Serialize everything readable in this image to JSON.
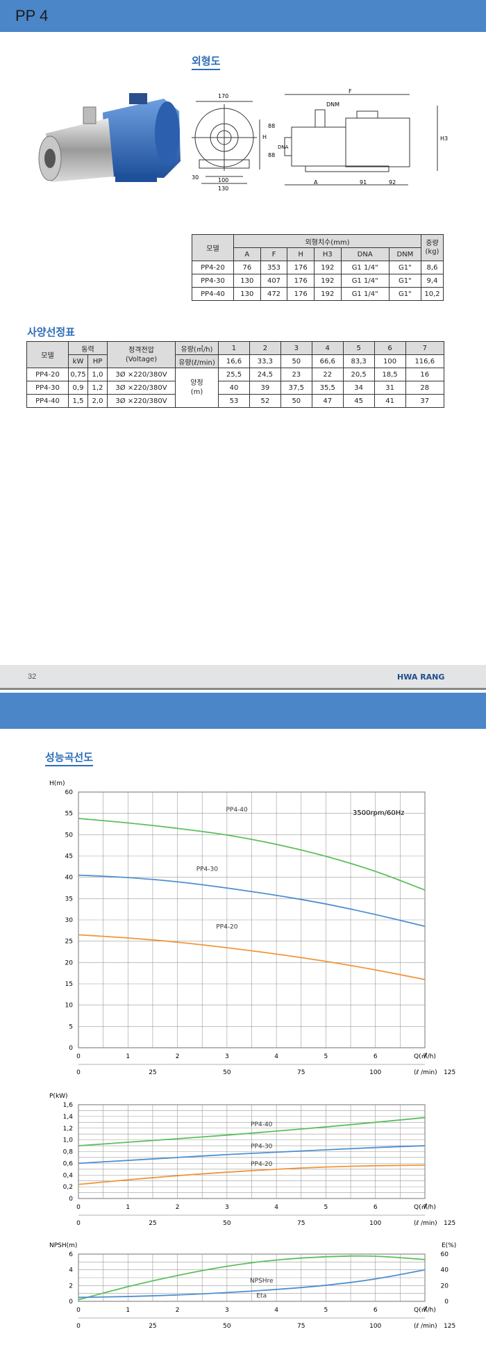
{
  "header": {
    "title": "PP 4"
  },
  "sections": {
    "dimension": "외형도",
    "selection": "사양선정표",
    "curves": "성능곡선도"
  },
  "drawing": {
    "labels": [
      "170",
      "F",
      "DNM",
      "H",
      "88",
      "88",
      "DNA",
      "H3",
      "30",
      "100",
      "130",
      "A",
      "91",
      "92"
    ]
  },
  "dim_table": {
    "h_model": "모델",
    "h_dims": "외형치수(mm)",
    "h_weight": "중량",
    "h_weight_unit": "(kg)",
    "cols": [
      "A",
      "F",
      "H",
      "H3",
      "DNA",
      "DNM"
    ],
    "rows": [
      [
        "PP4-20",
        "76",
        "353",
        "176",
        "192",
        "G1 1/4\"",
        "G1\"",
        "8,6"
      ],
      [
        "PP4-30",
        "130",
        "407",
        "176",
        "192",
        "G1 1/4\"",
        "G1\"",
        "9,4"
      ],
      [
        "PP4-40",
        "130",
        "472",
        "176",
        "192",
        "G1 1/4\"",
        "G1\"",
        "10,2"
      ]
    ]
  },
  "sel_table": {
    "h_model": "모델",
    "h_power": "동력",
    "h_kw": "kW",
    "h_hp": "HP",
    "h_voltage": "정격전압",
    "h_voltage2": "(Voltage)",
    "h_flow_m3": "유량(㎥/h)",
    "h_flow_l": "유량(ℓ/min)",
    "flow_m3": [
      "1",
      "2",
      "3",
      "4",
      "5",
      "6",
      "7"
    ],
    "flow_l": [
      "16,6",
      "33,3",
      "50",
      "66,6",
      "83,3",
      "100",
      "116,6"
    ],
    "h_head": "양정",
    "h_head2": "(m)",
    "rows": [
      {
        "model": "PP4-20",
        "kw": "0,75",
        "hp": "1,0",
        "v": "3Ø ×220/380V",
        "heads": [
          "25,5",
          "24,5",
          "23",
          "22",
          "20,5",
          "18,5",
          "16"
        ]
      },
      {
        "model": "PP4-30",
        "kw": "0,9",
        "hp": "1,2",
        "v": "3Ø ×220/380V",
        "heads": [
          "40",
          "39",
          "37,5",
          "35,5",
          "34",
          "31",
          "28"
        ]
      },
      {
        "model": "PP4-40",
        "kw": "1,5",
        "hp": "2,0",
        "v": "3Ø ×220/380V",
        "heads": [
          "53",
          "52",
          "50",
          "47",
          "45",
          "41",
          "37"
        ]
      }
    ]
  },
  "footer": {
    "page": "32",
    "logo": "HWA RANG"
  },
  "colors": {
    "pp4_20": "#f0953a",
    "pp4_30": "#4d8fd1",
    "pp4_40": "#5cbf5c",
    "band": "#4a86c8"
  },
  "chart_data": [
    {
      "type": "line",
      "ylabel": "H(m)",
      "xlabel": "Q(㎥/h)",
      "xlabel2": "(ℓ /min)",
      "annotation": "3500rpm/60Hz",
      "xlim": [
        0,
        7
      ],
      "ylim": [
        0,
        60
      ],
      "grid": true,
      "xticks": [
        "0",
        "1",
        "2",
        "3",
        "4",
        "5",
        "6",
        "7"
      ],
      "xticks2": [
        "0",
        "25",
        "50",
        "75",
        "100",
        "125"
      ],
      "yticks": [
        "0",
        "5",
        "10",
        "15",
        "20",
        "25",
        "30",
        "35",
        "40",
        "45",
        "50",
        "55",
        "60"
      ],
      "series": [
        {
          "name": "PP4-40",
          "color": "#5cbf5c",
          "x": [
            0,
            1,
            2,
            3,
            4,
            5,
            6,
            7
          ],
          "y": [
            53.8,
            52.8,
            51.5,
            50,
            47.8,
            45,
            41.5,
            37
          ]
        },
        {
          "name": "PP4-30",
          "color": "#4d8fd1",
          "x": [
            0,
            1,
            2,
            3,
            4,
            5,
            6,
            7
          ],
          "y": [
            40.5,
            40,
            39,
            37.5,
            35.8,
            33.8,
            31.3,
            28.5
          ]
        },
        {
          "name": "PP4-20",
          "color": "#f0953a",
          "x": [
            0,
            1,
            2,
            3,
            4,
            5,
            6,
            7
          ],
          "y": [
            26.5,
            25.8,
            24.8,
            23.5,
            22,
            20.3,
            18.3,
            16
          ]
        }
      ]
    },
    {
      "type": "line",
      "ylabel": "P(kW)",
      "xlabel": "Q(㎥/h)",
      "xlabel2": "(ℓ /min)",
      "xlim": [
        0,
        7
      ],
      "ylim": [
        0,
        1.6
      ],
      "grid": true,
      "xticks": [
        "0",
        "1",
        "2",
        "3",
        "4",
        "5",
        "6",
        "7"
      ],
      "xticks2": [
        "0",
        "25",
        "50",
        "75",
        "100",
        "125"
      ],
      "yticks": [
        "0",
        "0,2",
        "0,4",
        "0,6",
        "0,8",
        "1,0",
        "1,2",
        "1,4",
        "1,6"
      ],
      "series": [
        {
          "name": "PP4-40",
          "color": "#5cbf5c",
          "x": [
            0,
            1,
            2,
            3,
            4,
            5,
            6,
            7
          ],
          "y": [
            0.9,
            0.96,
            1.02,
            1.08,
            1.15,
            1.22,
            1.3,
            1.38
          ]
        },
        {
          "name": "PP4-30",
          "color": "#4d8fd1",
          "x": [
            0,
            1,
            2,
            3,
            4,
            5,
            6,
            7
          ],
          "y": [
            0.6,
            0.65,
            0.7,
            0.75,
            0.79,
            0.83,
            0.87,
            0.9
          ]
        },
        {
          "name": "PP4-20",
          "color": "#f0953a",
          "x": [
            0,
            1,
            2,
            3,
            4,
            5,
            6,
            7
          ],
          "y": [
            0.24,
            0.32,
            0.39,
            0.45,
            0.5,
            0.54,
            0.56,
            0.57
          ]
        }
      ]
    },
    {
      "type": "line",
      "ylabel": "NPSH(m)",
      "ylabel_right": "E(%)",
      "xlabel": "Q(㎥/h)",
      "xlabel2": "(ℓ /min)",
      "xlim": [
        0,
        7
      ],
      "ylim": [
        0,
        6
      ],
      "ylim_right": [
        0,
        60
      ],
      "grid": true,
      "xticks": [
        "0",
        "1",
        "2",
        "3",
        "4",
        "5",
        "6",
        "7"
      ],
      "xticks2": [
        "0",
        "25",
        "50",
        "75",
        "100",
        "125"
      ],
      "yticks": [
        "0",
        "2",
        "4",
        "6"
      ],
      "yticks_right": [
        "0",
        "20",
        "40",
        "60"
      ],
      "series": [
        {
          "name": "Eta",
          "color": "#5cbf5c",
          "axis": "right",
          "x": [
            0,
            1,
            2,
            3,
            4,
            5,
            6,
            7
          ],
          "y": [
            2,
            19,
            33,
            45,
            53,
            57,
            58,
            53
          ]
        },
        {
          "name": "NPSHre",
          "color": "#4d8fd1",
          "axis": "left",
          "x": [
            0,
            1,
            2,
            3,
            4,
            5,
            6,
            7
          ],
          "y": [
            0.5,
            0.6,
            0.8,
            1.1,
            1.5,
            2,
            2.8,
            4
          ]
        }
      ]
    }
  ]
}
